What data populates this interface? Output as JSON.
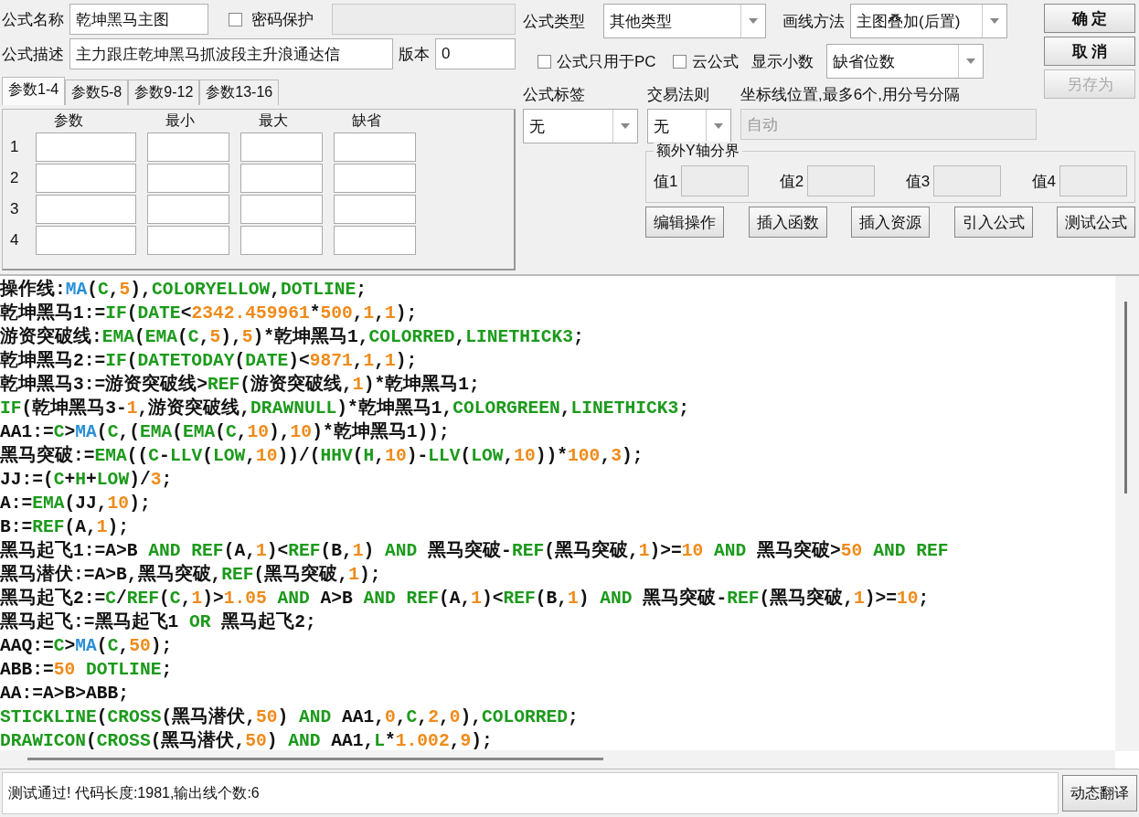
{
  "form": {
    "name_label": "公式名称",
    "name_value": "乾坤黑马主图",
    "password": {
      "label": "密码保护",
      "checked": false
    },
    "password_field": {
      "disabled": true
    },
    "desc_label": "公式描述",
    "desc_value": "主力跟庄乾坤黑马抓波段主升浪通达信",
    "version_label": "版本",
    "version_value": "0"
  },
  "param_tabs": [
    {
      "label": "参数1-4",
      "selected": true
    },
    {
      "label": "参数5-8",
      "selected": false
    },
    {
      "label": "参数9-12",
      "selected": false
    },
    {
      "label": "参数13-16",
      "selected": false
    }
  ],
  "param_columns": [
    "参数",
    "最小",
    "最大",
    "缺省"
  ],
  "param_rows": [
    "1",
    "2",
    "3",
    "4"
  ],
  "formula_type": {
    "label": "公式类型",
    "value": "其他类型"
  },
  "draw_method": {
    "label": "画线方法",
    "value": "主图叠加(后置)"
  },
  "options": [
    {
      "label": "公式只用于PC",
      "checked": false
    },
    {
      "label": "云公式",
      "checked": false
    }
  ],
  "decimals": {
    "label": "显示小数",
    "value": "缺省位数"
  },
  "tag": {
    "label": "公式标签",
    "value": "无"
  },
  "trade_rule": {
    "label": "交易法则",
    "value": "无"
  },
  "axis_lines": {
    "label": "坐标线位置,最多6个,用分号分隔",
    "value": "自动",
    "disabled": true
  },
  "y_bounds": {
    "title": "额外Y轴分界",
    "fields": [
      {
        "label": "值1",
        "disabled": true
      },
      {
        "label": "值2",
        "disabled": true
      },
      {
        "label": "值3",
        "disabled": true
      },
      {
        "label": "值4",
        "disabled": true
      }
    ]
  },
  "side_buttons": [
    {
      "label": "确 定",
      "disabled": false
    },
    {
      "label": "取 消",
      "disabled": false
    },
    {
      "label": "另存为",
      "disabled": true
    }
  ],
  "tool_buttons": [
    "编辑操作",
    "插入函数",
    "插入资源",
    "引入公式",
    "测试公式"
  ],
  "code_lines": [
    [
      {
        "kind": "plain",
        "text": "操作线:"
      },
      {
        "kind": "ma",
        "text": "MA"
      },
      {
        "kind": "plain",
        "text": "("
      },
      {
        "kind": "func",
        "text": "C"
      },
      {
        "kind": "plain",
        "text": ","
      },
      {
        "kind": "num",
        "text": "5"
      },
      {
        "kind": "plain",
        "text": "),"
      },
      {
        "kind": "func",
        "text": "COLORYELLOW"
      },
      {
        "kind": "plain",
        "text": ","
      },
      {
        "kind": "func",
        "text": "DOTLINE"
      },
      {
        "kind": "plain",
        "text": ";"
      }
    ],
    [
      {
        "kind": "plain",
        "text": "乾坤黑马1:="
      },
      {
        "kind": "func",
        "text": "IF"
      },
      {
        "kind": "plain",
        "text": "("
      },
      {
        "kind": "func",
        "text": "DATE"
      },
      {
        "kind": "plain",
        "text": "<"
      },
      {
        "kind": "num",
        "text": "2342.459961"
      },
      {
        "kind": "plain",
        "text": "*"
      },
      {
        "kind": "num",
        "text": "500"
      },
      {
        "kind": "plain",
        "text": ","
      },
      {
        "kind": "num",
        "text": "1"
      },
      {
        "kind": "plain",
        "text": ","
      },
      {
        "kind": "num",
        "text": "1"
      },
      {
        "kind": "plain",
        "text": ");"
      }
    ],
    [
      {
        "kind": "plain",
        "text": "游资突破线:"
      },
      {
        "kind": "func",
        "text": "EMA"
      },
      {
        "kind": "plain",
        "text": "("
      },
      {
        "kind": "func",
        "text": "EMA"
      },
      {
        "kind": "plain",
        "text": "("
      },
      {
        "kind": "func",
        "text": "C"
      },
      {
        "kind": "plain",
        "text": ","
      },
      {
        "kind": "num",
        "text": "5"
      },
      {
        "kind": "plain",
        "text": "),"
      },
      {
        "kind": "num",
        "text": "5"
      },
      {
        "kind": "plain",
        "text": ")*乾坤黑马1,"
      },
      {
        "kind": "func",
        "text": "COLORRED"
      },
      {
        "kind": "plain",
        "text": ","
      },
      {
        "kind": "func",
        "text": "LINETHICK3"
      },
      {
        "kind": "plain",
        "text": ";"
      }
    ],
    [
      {
        "kind": "plain",
        "text": "乾坤黑马2:="
      },
      {
        "kind": "func",
        "text": "IF"
      },
      {
        "kind": "plain",
        "text": "("
      },
      {
        "kind": "func",
        "text": "DATETODAY"
      },
      {
        "kind": "plain",
        "text": "("
      },
      {
        "kind": "func",
        "text": "DATE"
      },
      {
        "kind": "plain",
        "text": ")<"
      },
      {
        "kind": "num",
        "text": "9871"
      },
      {
        "kind": "plain",
        "text": ","
      },
      {
        "kind": "num",
        "text": "1"
      },
      {
        "kind": "plain",
        "text": ","
      },
      {
        "kind": "num",
        "text": "1"
      },
      {
        "kind": "plain",
        "text": ");"
      }
    ],
    [
      {
        "kind": "plain",
        "text": "乾坤黑马3:=游资突破线>"
      },
      {
        "kind": "func",
        "text": "REF"
      },
      {
        "kind": "plain",
        "text": "(游资突破线,"
      },
      {
        "kind": "num",
        "text": "1"
      },
      {
        "kind": "plain",
        "text": ")*乾坤黑马1;"
      }
    ],
    [
      {
        "kind": "func",
        "text": "IF"
      },
      {
        "kind": "plain",
        "text": "(乾坤黑马3-"
      },
      {
        "kind": "num",
        "text": "1"
      },
      {
        "kind": "plain",
        "text": ",游资突破线,"
      },
      {
        "kind": "func",
        "text": "DRAWNULL"
      },
      {
        "kind": "plain",
        "text": ")*乾坤黑马1,"
      },
      {
        "kind": "func",
        "text": "COLORGREEN"
      },
      {
        "kind": "plain",
        "text": ","
      },
      {
        "kind": "func",
        "text": "LINETHICK3"
      },
      {
        "kind": "plain",
        "text": ";"
      }
    ],
    [
      {
        "kind": "plain",
        "text": "AA1:="
      },
      {
        "kind": "func",
        "text": "C"
      },
      {
        "kind": "plain",
        "text": ">"
      },
      {
        "kind": "ma",
        "text": "MA"
      },
      {
        "kind": "plain",
        "text": "("
      },
      {
        "kind": "func",
        "text": "C"
      },
      {
        "kind": "plain",
        "text": ",("
      },
      {
        "kind": "func",
        "text": "EMA"
      },
      {
        "kind": "plain",
        "text": "("
      },
      {
        "kind": "func",
        "text": "EMA"
      },
      {
        "kind": "plain",
        "text": "("
      },
      {
        "kind": "func",
        "text": "C"
      },
      {
        "kind": "plain",
        "text": ","
      },
      {
        "kind": "num",
        "text": "10"
      },
      {
        "kind": "plain",
        "text": "),"
      },
      {
        "kind": "num",
        "text": "10"
      },
      {
        "kind": "plain",
        "text": ")*乾坤黑马1));"
      }
    ],
    [
      {
        "kind": "plain",
        "text": "黑马突破:="
      },
      {
        "kind": "func",
        "text": "EMA"
      },
      {
        "kind": "plain",
        "text": "(("
      },
      {
        "kind": "func",
        "text": "C"
      },
      {
        "kind": "plain",
        "text": "-"
      },
      {
        "kind": "func",
        "text": "LLV"
      },
      {
        "kind": "plain",
        "text": "("
      },
      {
        "kind": "func",
        "text": "LOW"
      },
      {
        "kind": "plain",
        "text": ","
      },
      {
        "kind": "num",
        "text": "10"
      },
      {
        "kind": "plain",
        "text": "))/("
      },
      {
        "kind": "func",
        "text": "HHV"
      },
      {
        "kind": "plain",
        "text": "("
      },
      {
        "kind": "func",
        "text": "H"
      },
      {
        "kind": "plain",
        "text": ","
      },
      {
        "kind": "num",
        "text": "10"
      },
      {
        "kind": "plain",
        "text": ")-"
      },
      {
        "kind": "func",
        "text": "LLV"
      },
      {
        "kind": "plain",
        "text": "("
      },
      {
        "kind": "func",
        "text": "LOW"
      },
      {
        "kind": "plain",
        "text": ","
      },
      {
        "kind": "num",
        "text": "10"
      },
      {
        "kind": "plain",
        "text": "))*"
      },
      {
        "kind": "num",
        "text": "100"
      },
      {
        "kind": "plain",
        "text": ","
      },
      {
        "kind": "num",
        "text": "3"
      },
      {
        "kind": "plain",
        "text": ");"
      }
    ],
    [
      {
        "kind": "plain",
        "text": "JJ:=("
      },
      {
        "kind": "func",
        "text": "C"
      },
      {
        "kind": "plain",
        "text": "+"
      },
      {
        "kind": "func",
        "text": "H"
      },
      {
        "kind": "plain",
        "text": "+"
      },
      {
        "kind": "func",
        "text": "LOW"
      },
      {
        "kind": "plain",
        "text": ")/"
      },
      {
        "kind": "num",
        "text": "3"
      },
      {
        "kind": "plain",
        "text": ";"
      }
    ],
    [
      {
        "kind": "plain",
        "text": "A:="
      },
      {
        "kind": "func",
        "text": "EMA"
      },
      {
        "kind": "plain",
        "text": "(JJ,"
      },
      {
        "kind": "num",
        "text": "10"
      },
      {
        "kind": "plain",
        "text": ");"
      }
    ],
    [
      {
        "kind": "plain",
        "text": "B:="
      },
      {
        "kind": "func",
        "text": "REF"
      },
      {
        "kind": "plain",
        "text": "(A,"
      },
      {
        "kind": "num",
        "text": "1"
      },
      {
        "kind": "plain",
        "text": ");"
      }
    ],
    [
      {
        "kind": "plain",
        "text": "黑马起飞1:=A>B "
      },
      {
        "kind": "func",
        "text": "AND"
      },
      {
        "kind": "func",
        "text": " REF"
      },
      {
        "kind": "plain",
        "text": "(A,"
      },
      {
        "kind": "num",
        "text": "1"
      },
      {
        "kind": "plain",
        "text": ")<"
      },
      {
        "kind": "func",
        "text": "REF"
      },
      {
        "kind": "plain",
        "text": "(B,"
      },
      {
        "kind": "num",
        "text": "1"
      },
      {
        "kind": "plain",
        "text": ") "
      },
      {
        "kind": "func",
        "text": "AND"
      },
      {
        "kind": "plain",
        "text": " 黑马突破-"
      },
      {
        "kind": "func",
        "text": "REF"
      },
      {
        "kind": "plain",
        "text": "(黑马突破,"
      },
      {
        "kind": "num",
        "text": "1"
      },
      {
        "kind": "plain",
        "text": ")>="
      },
      {
        "kind": "num",
        "text": "10"
      },
      {
        "kind": "func",
        "text": " AND"
      },
      {
        "kind": "plain",
        "text": " 黑马突破>"
      },
      {
        "kind": "num",
        "text": "50"
      },
      {
        "kind": "func",
        "text": " AND"
      },
      {
        "kind": "func",
        "text": " REF"
      }
    ],
    [
      {
        "kind": "plain",
        "text": "黑马潜伏:=A>B,黑马突破,"
      },
      {
        "kind": "func",
        "text": "REF"
      },
      {
        "kind": "plain",
        "text": "(黑马突破,"
      },
      {
        "kind": "num",
        "text": "1"
      },
      {
        "kind": "plain",
        "text": ");"
      }
    ],
    [
      {
        "kind": "plain",
        "text": "黑马起飞2:="
      },
      {
        "kind": "func",
        "text": "C"
      },
      {
        "kind": "plain",
        "text": "/"
      },
      {
        "kind": "func",
        "text": "REF"
      },
      {
        "kind": "plain",
        "text": "("
      },
      {
        "kind": "func",
        "text": "C"
      },
      {
        "kind": "plain",
        "text": ","
      },
      {
        "kind": "num",
        "text": "1"
      },
      {
        "kind": "plain",
        "text": ")>"
      },
      {
        "kind": "num",
        "text": "1.05"
      },
      {
        "kind": "func",
        "text": " AND"
      },
      {
        "kind": "plain",
        "text": " A>B "
      },
      {
        "kind": "func",
        "text": "AND"
      },
      {
        "kind": "func",
        "text": " REF"
      },
      {
        "kind": "plain",
        "text": "(A,"
      },
      {
        "kind": "num",
        "text": "1"
      },
      {
        "kind": "plain",
        "text": ")<"
      },
      {
        "kind": "func",
        "text": "REF"
      },
      {
        "kind": "plain",
        "text": "(B,"
      },
      {
        "kind": "num",
        "text": "1"
      },
      {
        "kind": "plain",
        "text": ") "
      },
      {
        "kind": "func",
        "text": "AND"
      },
      {
        "kind": "plain",
        "text": " 黑马突破-"
      },
      {
        "kind": "func",
        "text": "REF"
      },
      {
        "kind": "plain",
        "text": "(黑马突破,"
      },
      {
        "kind": "num",
        "text": "1"
      },
      {
        "kind": "plain",
        "text": ")>="
      },
      {
        "kind": "num",
        "text": "10"
      },
      {
        "kind": "plain",
        "text": ";"
      }
    ],
    [
      {
        "kind": "plain",
        "text": "黑马起飞:=黑马起飞1 "
      },
      {
        "kind": "func",
        "text": "OR"
      },
      {
        "kind": "plain",
        "text": " 黑马起飞2;"
      }
    ],
    [
      {
        "kind": "plain",
        "text": "AAQ:="
      },
      {
        "kind": "func",
        "text": "C"
      },
      {
        "kind": "plain",
        "text": ">"
      },
      {
        "kind": "ma",
        "text": "MA"
      },
      {
        "kind": "plain",
        "text": "("
      },
      {
        "kind": "func",
        "text": "C"
      },
      {
        "kind": "plain",
        "text": ","
      },
      {
        "kind": "num",
        "text": "50"
      },
      {
        "kind": "plain",
        "text": ");"
      }
    ],
    [
      {
        "kind": "plain",
        "text": "ABB:="
      },
      {
        "kind": "num",
        "text": "50"
      },
      {
        "kind": "func",
        "text": " DOTLINE"
      },
      {
        "kind": "plain",
        "text": ";"
      }
    ],
    [
      {
        "kind": "plain",
        "text": "AA:=A>B>ABB;"
      }
    ],
    [
      {
        "kind": "func",
        "text": "STICKLINE"
      },
      {
        "kind": "plain",
        "text": "("
      },
      {
        "kind": "func",
        "text": "CROSS"
      },
      {
        "kind": "plain",
        "text": "(黑马潜伏,"
      },
      {
        "kind": "num",
        "text": "50"
      },
      {
        "kind": "plain",
        "text": ") "
      },
      {
        "kind": "func",
        "text": "AND"
      },
      {
        "kind": "plain",
        "text": " AA1,"
      },
      {
        "kind": "num",
        "text": "0"
      },
      {
        "kind": "plain",
        "text": ","
      },
      {
        "kind": "func",
        "text": "C"
      },
      {
        "kind": "plain",
        "text": ","
      },
      {
        "kind": "num",
        "text": "2"
      },
      {
        "kind": "plain",
        "text": ","
      },
      {
        "kind": "num",
        "text": "0"
      },
      {
        "kind": "plain",
        "text": "),"
      },
      {
        "kind": "func",
        "text": "COLORRED"
      },
      {
        "kind": "plain",
        "text": ";"
      }
    ],
    [
      {
        "kind": "func",
        "text": "DRAWICON"
      },
      {
        "kind": "plain",
        "text": "("
      },
      {
        "kind": "func",
        "text": "CROSS"
      },
      {
        "kind": "plain",
        "text": "(黑马潜伏,"
      },
      {
        "kind": "num",
        "text": "50"
      },
      {
        "kind": "plain",
        "text": ") "
      },
      {
        "kind": "func",
        "text": "AND"
      },
      {
        "kind": "plain",
        "text": " AA1,"
      },
      {
        "kind": "func",
        "text": "L"
      },
      {
        "kind": "plain",
        "text": "*"
      },
      {
        "kind": "num",
        "text": "1.002"
      },
      {
        "kind": "plain",
        "text": ","
      },
      {
        "kind": "num",
        "text": "9"
      },
      {
        "kind": "plain",
        "text": ");"
      }
    ]
  ],
  "status": {
    "text": "测试通过! 代码长度:1981,输出线个数:6",
    "button": "动态翻译"
  }
}
